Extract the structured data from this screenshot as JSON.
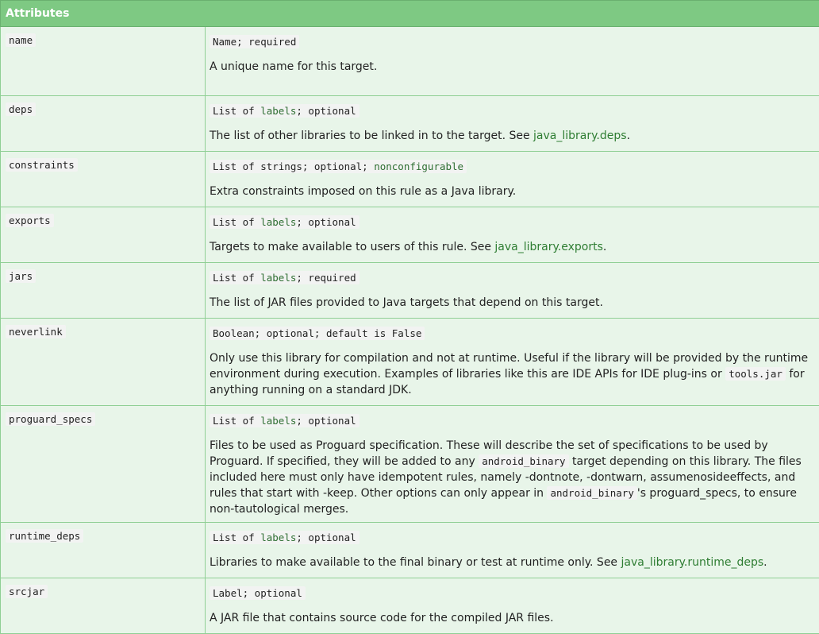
{
  "header": {
    "title": "Attributes"
  },
  "rows": [
    {
      "name": "name",
      "type": "Name; required",
      "desc": "A unique name for this target."
    },
    {
      "name": "deps",
      "type_pre": "List of ",
      "type_label": "labels",
      "type_post": "; optional",
      "desc_pre": "The list of other libraries to be linked in to the target. See ",
      "desc_link": "java_library.deps",
      "desc_post": "."
    },
    {
      "name": "constraints",
      "type_pre": "List of strings; optional; ",
      "type_label": "nonconfigurable",
      "desc": "Extra constraints imposed on this rule as a Java library."
    },
    {
      "name": "exports",
      "type_pre": "List of ",
      "type_label": "labels",
      "type_post": "; optional",
      "desc_pre": "Targets to make available to users of this rule. See ",
      "desc_link": "java_library.exports",
      "desc_post": "."
    },
    {
      "name": "jars",
      "type_pre": "List of ",
      "type_label": "labels",
      "type_post": "; required",
      "desc": "The list of JAR files provided to Java targets that depend on this target."
    },
    {
      "name": "neverlink",
      "type": "Boolean; optional; default is False",
      "desc_pre": "Only use this library for compilation and not at runtime. Useful if the library will be provided by the runtime environment during execution. Examples of libraries like this are IDE APIs for IDE plug-ins or ",
      "desc_code": "tools.jar",
      "desc_post": " for anything running on a standard JDK."
    },
    {
      "name": "proguard_specs",
      "type_pre": "List of ",
      "type_label": "labels",
      "type_post": "; optional",
      "desc_a": "Files to be used as Proguard specification. These will describe the set of specifications to be used by Proguard. If specified, they will be added to any ",
      "desc_code1": "android_binary",
      "desc_b": " target depending on this library. The files included here must only have idempotent rules, namely -dontnote, -dontwarn, assumenosideeffects, and rules that start with -keep. Other options can only appear in ",
      "desc_code2": "android_binary",
      "desc_c": "'s proguard_specs, to ensure non-tautological merges."
    },
    {
      "name": "runtime_deps",
      "type_pre": "List of ",
      "type_label": "labels",
      "type_post": "; optional",
      "desc_pre": "Libraries to make available to the final binary or test at runtime only. See ",
      "desc_link": "java_library.runtime_deps",
      "desc_post": "."
    },
    {
      "name": "srcjar",
      "type": "Label; optional",
      "desc": "A JAR file that contains source code for the compiled JAR files."
    }
  ]
}
